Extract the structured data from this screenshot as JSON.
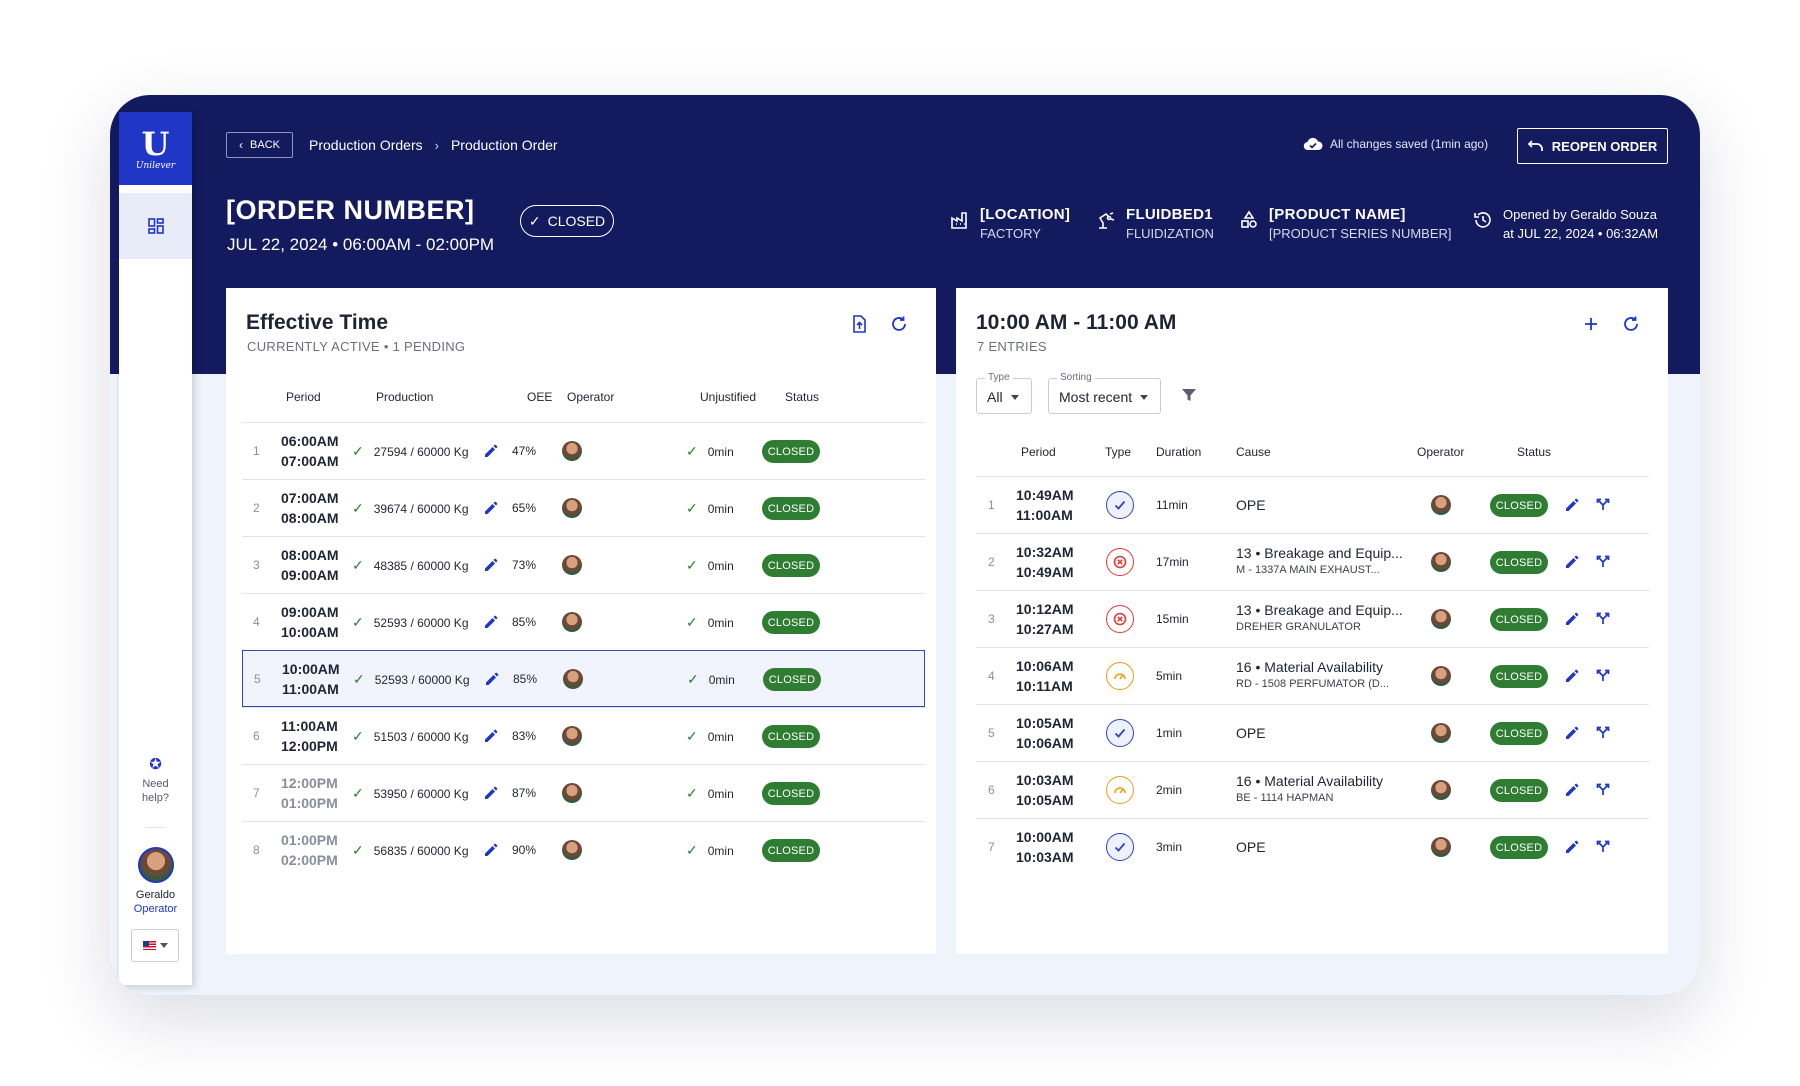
{
  "sidebar": {
    "logo_letter": "U",
    "logo_text": "Unilever",
    "help_label": "Need help?",
    "user_name": "Geraldo",
    "user_role": "Operator"
  },
  "header": {
    "back_label": "BACK",
    "breadcrumb": [
      "Production Orders",
      "Production Order"
    ],
    "save_status": "All changes saved (1min ago)",
    "reopen_label": "REOPEN ORDER",
    "order_title": "[ORDER NUMBER]",
    "order_time": "JUL 22, 2024 • 06:00AM - 02:00PM",
    "status": "CLOSED",
    "location": {
      "title": "[LOCATION]",
      "sub": "FACTORY"
    },
    "equipment": {
      "title": "FLUIDBED1",
      "sub": "FLUIDIZATION"
    },
    "product": {
      "title": "[PRODUCT NAME]",
      "sub": "[PRODUCT SERIES NUMBER]"
    },
    "opened": {
      "line1": "Opened by Geraldo Souza",
      "line2": "at JUL 22, 2024 • 06:32AM"
    }
  },
  "effective": {
    "title": "Effective Time",
    "subtitle": "CURRENTLY ACTIVE • 1 PENDING",
    "columns": [
      "Period",
      "Production",
      "OEE",
      "Operator",
      "Unjustified",
      "Status"
    ],
    "rows": [
      {
        "n": "1",
        "start": "06:00AM",
        "end": "07:00AM",
        "production": "27594 / 60000 Kg",
        "oee": "47%",
        "unjustified": "0min",
        "status": "CLOSED"
      },
      {
        "n": "2",
        "start": "07:00AM",
        "end": "08:00AM",
        "production": "39674 / 60000 Kg",
        "oee": "65%",
        "unjustified": "0min",
        "status": "CLOSED"
      },
      {
        "n": "3",
        "start": "08:00AM",
        "end": "09:00AM",
        "production": "48385 / 60000 Kg",
        "oee": "73%",
        "unjustified": "0min",
        "status": "CLOSED"
      },
      {
        "n": "4",
        "start": "09:00AM",
        "end": "10:00AM",
        "production": "52593 / 60000 Kg",
        "oee": "85%",
        "unjustified": "0min",
        "status": "CLOSED"
      },
      {
        "n": "5",
        "start": "10:00AM",
        "end": "11:00AM",
        "production": "52593 / 60000 Kg",
        "oee": "85%",
        "unjustified": "0min",
        "status": "CLOSED"
      },
      {
        "n": "6",
        "start": "11:00AM",
        "end": "12:00PM",
        "production": "51503 / 60000 Kg",
        "oee": "83%",
        "unjustified": "0min",
        "status": "CLOSED"
      },
      {
        "n": "7",
        "start": "12:00PM",
        "end": "01:00PM",
        "production": "53950 / 60000 Kg",
        "oee": "87%",
        "unjustified": "0min",
        "status": "CLOSED"
      },
      {
        "n": "8",
        "start": "01:00PM",
        "end": "02:00PM",
        "production": "56835 / 60000 Kg",
        "oee": "90%",
        "unjustified": "0min",
        "status": "CLOSED"
      }
    ]
  },
  "events": {
    "title": "10:00 AM - 11:00 AM",
    "subtitle": "7 ENTRIES",
    "type_filter": {
      "label": "Type",
      "value": "All"
    },
    "sort_filter": {
      "label": "Sorting",
      "value": "Most recent"
    },
    "columns": [
      "Period",
      "Type",
      "Duration",
      "Cause",
      "Operator",
      "Status"
    ],
    "rows": [
      {
        "n": "1",
        "start": "10:49AM",
        "end": "11:00AM",
        "type": "ope",
        "duration": "11min",
        "cause": "OPE",
        "detail": "",
        "status": "CLOSED"
      },
      {
        "n": "2",
        "start": "10:32AM",
        "end": "10:49AM",
        "type": "break",
        "duration": "17min",
        "cause": "13 • Breakage and Equip...",
        "detail": "M - 1337A MAIN EXHAUST...",
        "status": "CLOSED"
      },
      {
        "n": "3",
        "start": "10:12AM",
        "end": "10:27AM",
        "type": "break",
        "duration": "15min",
        "cause": "13 • Breakage and Equip...",
        "detail": "DREHER GRANULATOR",
        "status": "CLOSED"
      },
      {
        "n": "4",
        "start": "10:06AM",
        "end": "10:11AM",
        "type": "avail",
        "duration": "5min",
        "cause": "16 • Material Availability",
        "detail": "RD - 1508 PERFUMATOR (D...",
        "status": "CLOSED"
      },
      {
        "n": "5",
        "start": "10:05AM",
        "end": "10:06AM",
        "type": "ope",
        "duration": "1min",
        "cause": "OPE",
        "detail": "",
        "status": "CLOSED"
      },
      {
        "n": "6",
        "start": "10:03AM",
        "end": "10:05AM",
        "type": "avail",
        "duration": "2min",
        "cause": "16 • Material Availability",
        "detail": "BE - 1114 HAPMAN",
        "status": "CLOSED"
      },
      {
        "n": "7",
        "start": "10:00AM",
        "end": "10:03AM",
        "type": "ope",
        "duration": "3min",
        "cause": "OPE",
        "detail": "",
        "status": "CLOSED"
      }
    ]
  },
  "colors": {
    "navy": "#131a5e",
    "accent": "#1f36c7",
    "success": "#2e7d32",
    "error": "#e53935",
    "warning": "#f39c12"
  }
}
